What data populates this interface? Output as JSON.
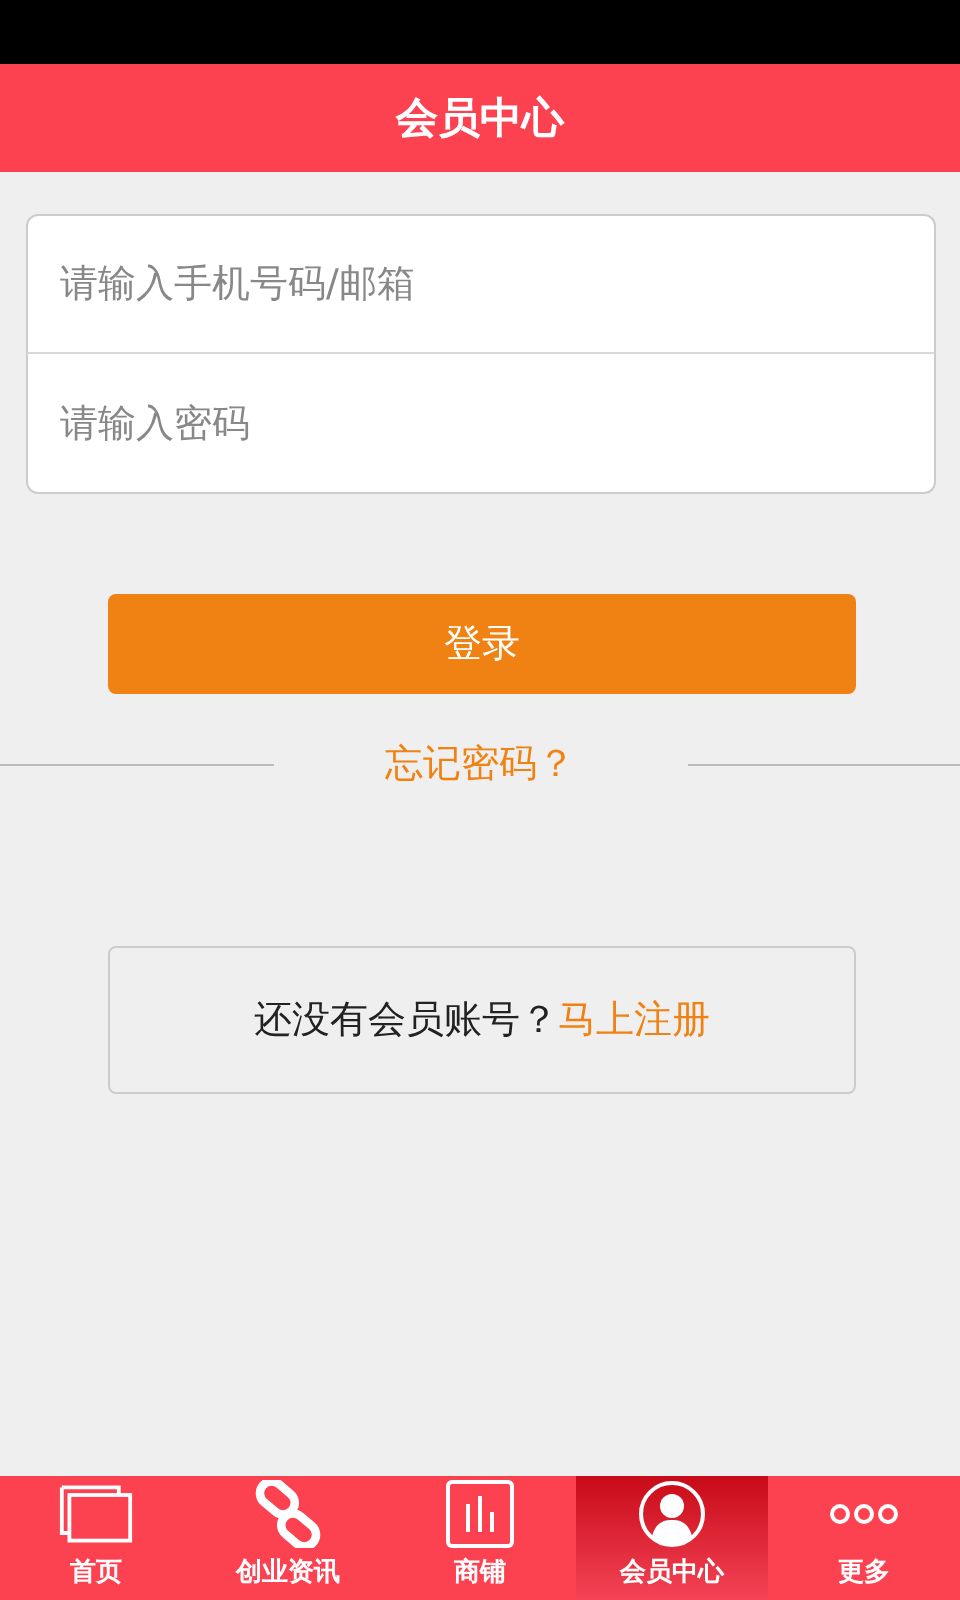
{
  "header": {
    "title": "会员中心"
  },
  "form": {
    "fields": [
      {
        "placeholder": "请输入手机号码/邮箱"
      },
      {
        "placeholder": "请输入密码"
      }
    ]
  },
  "login_button": "登录",
  "forgot_link": "忘记密码？",
  "register": {
    "text": "还没有会员账号？",
    "link": "马上注册"
  },
  "tabs": [
    {
      "label": "首页",
      "kind": "windows",
      "selected": false
    },
    {
      "label": "创业资讯",
      "kind": "link",
      "selected": false
    },
    {
      "label": "商铺",
      "kind": "chart",
      "selected": false
    },
    {
      "label": "会员中心",
      "kind": "person",
      "selected": true
    },
    {
      "label": "更多",
      "kind": "more",
      "selected": false
    }
  ]
}
